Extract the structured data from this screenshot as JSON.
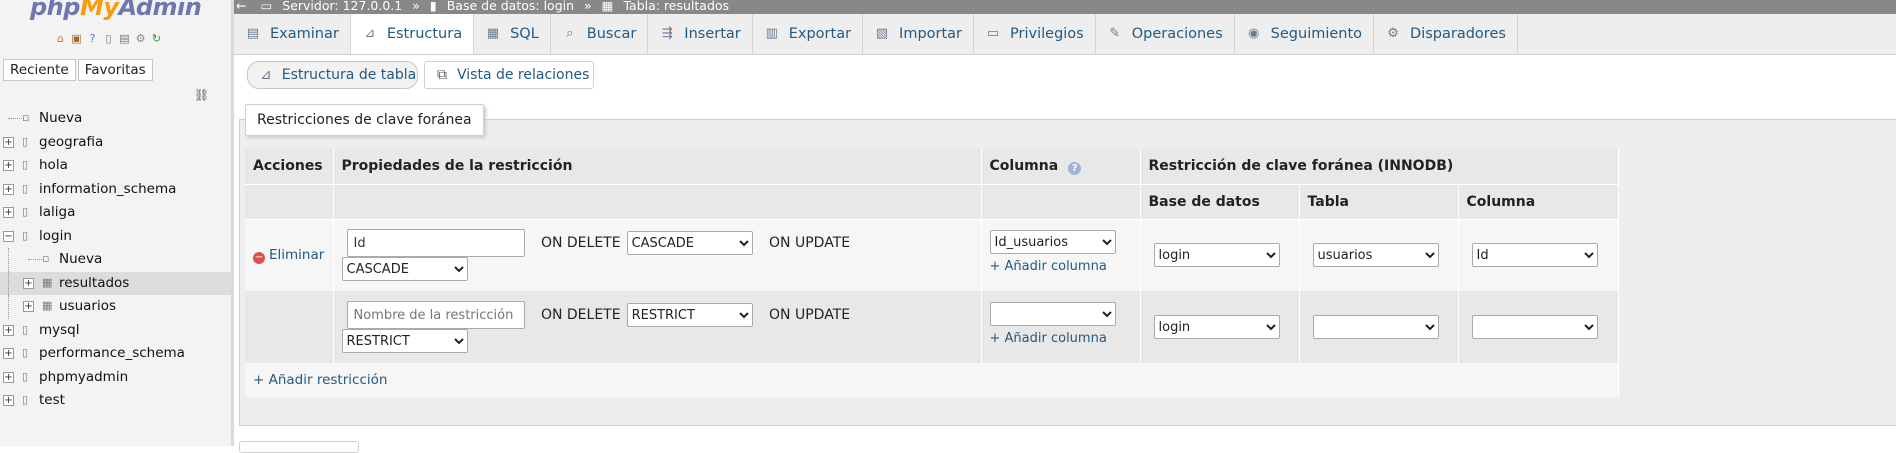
{
  "nav": {
    "logo": {
      "php": "php",
      "my": "My",
      "admin": "Admin"
    },
    "tabs": [
      "Reciente",
      "Favoritas"
    ],
    "tree": [
      {
        "label": "Nueva",
        "level": 0,
        "type": "new"
      },
      {
        "label": "geografia",
        "level": 0,
        "type": "db"
      },
      {
        "label": "hola",
        "level": 0,
        "type": "db"
      },
      {
        "label": "information_schema",
        "level": 0,
        "type": "db"
      },
      {
        "label": "laliga",
        "level": 0,
        "type": "db"
      },
      {
        "label": "login",
        "level": 0,
        "type": "db-open"
      },
      {
        "label": "Nueva",
        "level": 1,
        "type": "new"
      },
      {
        "label": "resultados",
        "level": 1,
        "type": "table"
      },
      {
        "label": "usuarios",
        "level": 1,
        "type": "table"
      },
      {
        "label": "mysql",
        "level": 0,
        "type": "db"
      },
      {
        "label": "performance_schema",
        "level": 0,
        "type": "db"
      },
      {
        "label": "phpmyadmin",
        "level": 0,
        "type": "db"
      },
      {
        "label": "test",
        "level": 0,
        "type": "db"
      }
    ]
  },
  "breadcrumb": {
    "server": "Servidor: 127.0.0.1",
    "database": "Base de datos: login",
    "table": "Tabla: resultados",
    "sep": "»"
  },
  "tabs": [
    {
      "label": "Examinar",
      "icon": "browse-icon"
    },
    {
      "label": "Estructura",
      "icon": "structure-icon"
    },
    {
      "label": "SQL",
      "icon": "sql-icon"
    },
    {
      "label": "Buscar",
      "icon": "search-icon"
    },
    {
      "label": "Insertar",
      "icon": "insert-icon"
    },
    {
      "label": "Exportar",
      "icon": "export-icon"
    },
    {
      "label": "Importar",
      "icon": "import-icon"
    },
    {
      "label": "Privilegios",
      "icon": "privileges-icon"
    },
    {
      "label": "Operaciones",
      "icon": "wrench-icon"
    },
    {
      "label": "Seguimiento",
      "icon": "eye-icon"
    },
    {
      "label": "Disparadores",
      "icon": "triggers-icon"
    }
  ],
  "active_tab": "Estructura",
  "subtabs": {
    "structure": "Estructura de tabla",
    "relations": "Vista de relaciones"
  },
  "fieldset": {
    "legend": "Restricciones de clave foránea"
  },
  "table": {
    "headers": {
      "actions": "Acciones",
      "properties": "Propiedades de la restricción",
      "column": "Columna",
      "fk_group": "Restricción de clave foránea (INNODB)",
      "database": "Base de datos",
      "table": "Tabla",
      "column2": "Columna"
    },
    "rows": [
      {
        "action": "Eliminar",
        "name_value": "Id",
        "name_placeholder": "Nombre de la restricción",
        "on_delete_label": "ON DELETE",
        "on_delete": "CASCADE",
        "on_update_label": "ON UPDATE",
        "on_update": "CASCADE",
        "column": "Id_usuarios",
        "add_column": "+ Añadir columna",
        "ref_db": "login",
        "ref_table": "usuarios",
        "ref_column": "Id"
      },
      {
        "action": "",
        "name_value": "",
        "name_placeholder": "Nombre de la restricción",
        "on_delete_label": "ON DELETE",
        "on_delete": "RESTRICT",
        "on_update_label": "ON UPDATE",
        "on_update": "RESTRICT",
        "column": "",
        "add_column": "+ Añadir columna",
        "ref_db": "login",
        "ref_table": "",
        "ref_column": ""
      }
    ],
    "add_constraint": "+ Añadir restricción"
  }
}
